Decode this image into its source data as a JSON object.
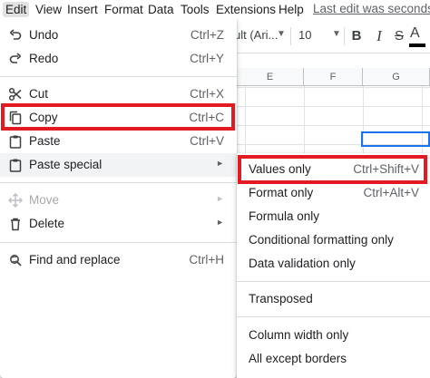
{
  "menubar": {
    "items": [
      {
        "label": "Edit",
        "active": true
      },
      {
        "label": "View"
      },
      {
        "label": "Insert"
      },
      {
        "label": "Format"
      },
      {
        "label": "Data"
      },
      {
        "label": "Tools"
      },
      {
        "label": "Extensions"
      },
      {
        "label": "Help"
      }
    ],
    "last_edit": "Last edit was seconds ag"
  },
  "toolbar": {
    "font": "ult (Ari...",
    "font_size": "10",
    "bold": "B",
    "italic": "I",
    "strikethrough": "S",
    "text_color": "A",
    "text_color_bar": "#000000"
  },
  "grid": {
    "columns": [
      "E",
      "F",
      "G"
    ]
  },
  "edit_menu": {
    "items": [
      {
        "label": "Undo",
        "shortcut": "Ctrl+Z",
        "icon": "undo-icon"
      },
      {
        "label": "Redo",
        "shortcut": "Ctrl+Y",
        "icon": "redo-icon"
      },
      {
        "label": "Cut",
        "shortcut": "Ctrl+X",
        "icon": "cut-icon"
      },
      {
        "label": "Copy",
        "shortcut": "Ctrl+C",
        "icon": "copy-icon",
        "highlighted": true
      },
      {
        "label": "Paste",
        "shortcut": "Ctrl+V",
        "icon": "paste-icon"
      },
      {
        "label": "Paste special",
        "icon": "paste-special-icon",
        "submenu": true,
        "hover": true
      },
      {
        "label": "Move",
        "icon": "move-icon",
        "submenu": true,
        "disabled": true
      },
      {
        "label": "Delete",
        "icon": "delete-icon",
        "submenu": true
      },
      {
        "label": "Find and replace",
        "shortcut": "Ctrl+H",
        "icon": "find-replace-icon"
      }
    ]
  },
  "paste_special_menu": {
    "items": [
      {
        "label": "Values only",
        "shortcut": "Ctrl+Shift+V",
        "highlighted": true
      },
      {
        "label": "Format only",
        "shortcut": "Ctrl+Alt+V"
      },
      {
        "label": "Formula only"
      },
      {
        "label": "Conditional formatting only"
      },
      {
        "label": "Data validation only"
      },
      {
        "label": "Transposed"
      },
      {
        "label": "Column width only"
      },
      {
        "label": "All except borders"
      }
    ]
  },
  "colors": {
    "highlight_border": "#e21b23",
    "selection_border": "#1a73e8",
    "menu_hover": "#f1f3f4",
    "menubar_active": "#e2e2e2"
  },
  "arrow_glyph": "►"
}
